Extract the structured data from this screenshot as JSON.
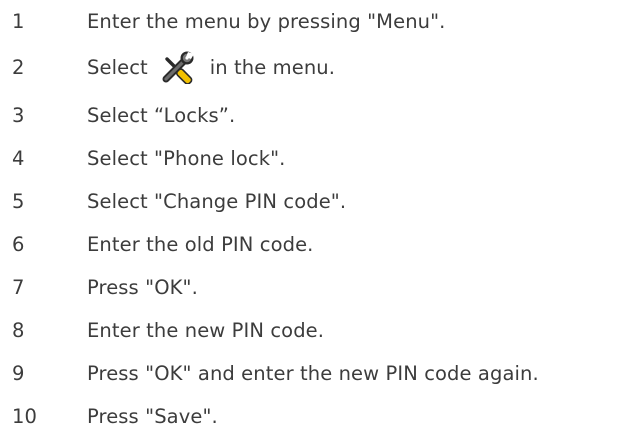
{
  "steps": [
    {
      "number": "1",
      "text": "Enter the menu by pressing \"Menu\"."
    },
    {
      "number": "2",
      "before": "Select",
      "icon": "tools-icon",
      "after": "in the menu."
    },
    {
      "number": "3",
      "text": "Select “Locks”."
    },
    {
      "number": "4",
      "text": "Select \"Phone lock\"."
    },
    {
      "number": "5",
      "text": "Select \"Change PIN code\"."
    },
    {
      "number": "6",
      "text": "Enter the old PIN code."
    },
    {
      "number": "7",
      "text": "Press \"OK\"."
    },
    {
      "number": "8",
      "text": "Enter the new PIN code."
    },
    {
      "number": "9",
      "text": "Press \"OK\" and enter the new PIN code again."
    },
    {
      "number": "10",
      "text": "Press \"Save\"."
    }
  ]
}
